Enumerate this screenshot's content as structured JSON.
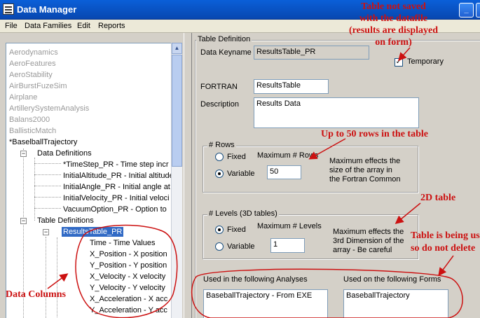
{
  "window": {
    "title": "Data Manager",
    "minimize_label": "_"
  },
  "menu": [
    {
      "label": "File"
    },
    {
      "label": "Data Families"
    },
    {
      "label": "Edit"
    },
    {
      "label": "Reports"
    }
  ],
  "tree": {
    "families": [
      "Aerodynamics",
      "AeroFeatures",
      "AeroStability",
      "AirBurstFuzeSim",
      "Airplane",
      "ArtillerySystemAnalysis",
      "Balans2000",
      "BallisticMatch"
    ],
    "current_family": "*BaselballTrajectory",
    "data_definitions_label": "Data Definitions",
    "data_definitions": [
      "*TimeStep_PR  -  Time step incr",
      "InitialAltitude_PR  -  Initial altitude",
      "InitialAngle_PR  -  Initial angle at",
      "InitialVelocity_PR  -  Initial veloci",
      "VacuumOption_PR  -  Option to"
    ],
    "table_definitions_label": "Table Definitions",
    "selected_table": "ResultsTable_PR",
    "columns": [
      "Time  -  Time Values",
      "X_Position  -  X position",
      "Y_Position  -  Y position",
      "X_Velocity  -  X velocity",
      "Y_Velocity  -  Y velocity",
      "X_Acceleration  -  X acc",
      "Y_Acceleration  -  Y acc"
    ],
    "toggle_minus": "−"
  },
  "table_definition": {
    "group_title": "Table Definition",
    "keyname_label": "Data Keyname",
    "keyname_value": "ResultsTable_PR",
    "temporary_label": "Temporary",
    "temporary_checked": true,
    "check_mark": "✓",
    "fortran_label": "FORTRAN",
    "fortran_value": "ResultsTable",
    "description_label": "Description",
    "description_value": "Results Data"
  },
  "rows": {
    "group_title": "# Rows",
    "fixed_label": "Fixed",
    "variable_label": "Variable",
    "selected": "Variable",
    "max_label": "Maximum # Rows",
    "max_value": "50",
    "note_lines": [
      "Maximum effects the",
      "size of the array in",
      "the Fortran Common"
    ]
  },
  "levels": {
    "group_title": "# Levels (3D tables)",
    "fixed_label": "Fixed",
    "variable_label": "Variable",
    "selected": "Fixed",
    "max_label": "Maximum # Levels",
    "max_value": "1",
    "note_lines": [
      "Maximum effects the",
      "3rd Dimension of the",
      "array - Be careful"
    ]
  },
  "usage": {
    "analyses_label": "Used in the following Analyses",
    "analyses_items": [
      "BaseballTrajectory  -  From EXE"
    ],
    "forms_label": "Used on the following Forms",
    "forms_items": [
      "BaseballTrajectory"
    ]
  },
  "annotations": {
    "temporary_note": [
      "Table not saved",
      "with the datafile",
      "(results are displayed",
      "on form)"
    ],
    "rows_note": "Up to 50 rows in the table",
    "table_2d_note": "2D table",
    "in_use_note": [
      "Table is being us",
      "so do not delete"
    ],
    "columns_note": "Data Columns",
    "color": "#cc1111"
  },
  "colors": {
    "titlebar": "#0a5fd8",
    "selection": "#316ac5",
    "annotation": "#cc1111"
  }
}
